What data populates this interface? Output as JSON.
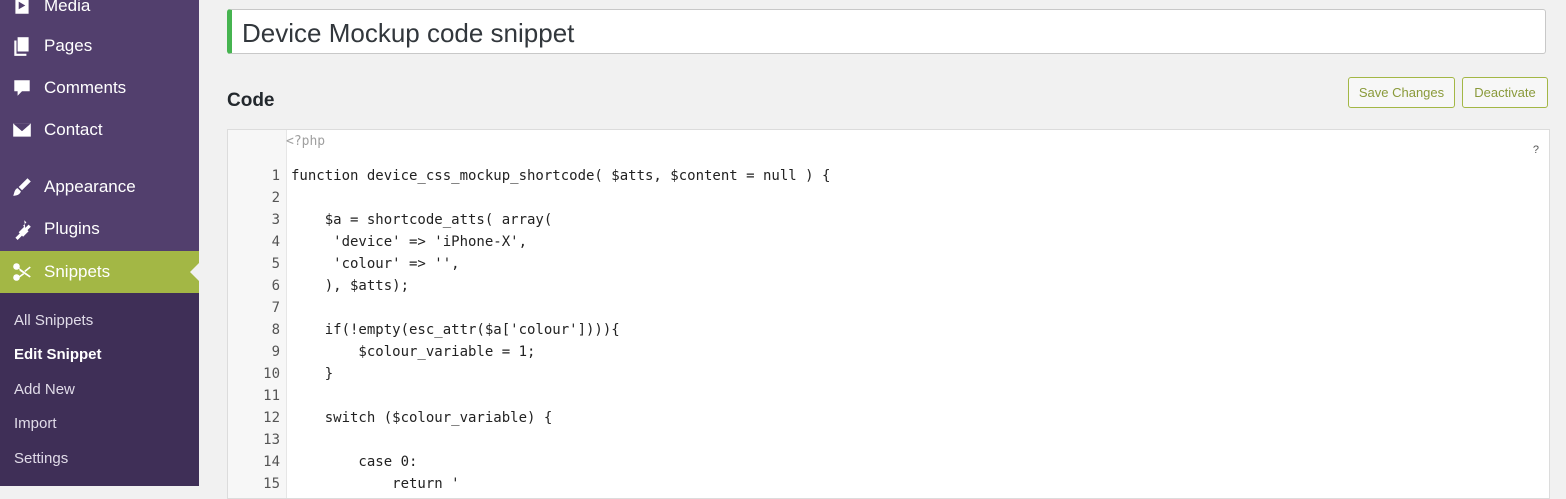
{
  "sidebar": {
    "items": [
      {
        "label": "Media",
        "icon": "media-icon"
      },
      {
        "label": "Pages",
        "icon": "pages-icon"
      },
      {
        "label": "Comments",
        "icon": "comments-icon"
      },
      {
        "label": "Contact",
        "icon": "mail-icon"
      },
      {
        "label": "Appearance",
        "icon": "paintbrush-icon"
      },
      {
        "label": "Plugins",
        "icon": "plugin-icon"
      },
      {
        "label": "Snippets",
        "icon": "scissors-icon"
      }
    ],
    "submenu": [
      "All Snippets",
      "Edit Snippet",
      "Add New",
      "Import",
      "Settings"
    ]
  },
  "title_value": "Device Mockup code snippet",
  "section_title": "Code",
  "buttons": {
    "save": "Save Changes",
    "deactivate": "Deactivate"
  },
  "editor": {
    "php_tag": "<?php",
    "help": "?",
    "lines": [
      {
        "n": "1",
        "code": "function device_css_mockup_shortcode( $atts, $content = null ) {"
      },
      {
        "n": "2",
        "code": ""
      },
      {
        "n": "3",
        "code": "    $a = shortcode_atts( array("
      },
      {
        "n": "4",
        "code": "     'device' => 'iPhone-X',"
      },
      {
        "n": "5",
        "code": "     'colour' => '',"
      },
      {
        "n": "6",
        "code": "    ), $atts);"
      },
      {
        "n": "7",
        "code": ""
      },
      {
        "n": "8",
        "code": "    if(!empty(esc_attr($a['colour']))){"
      },
      {
        "n": "9",
        "code": "        $colour_variable = 1;"
      },
      {
        "n": "10",
        "code": "    }"
      },
      {
        "n": "11",
        "code": ""
      },
      {
        "n": "12",
        "code": "    switch ($colour_variable) {"
      },
      {
        "n": "13",
        "code": ""
      },
      {
        "n": "14",
        "code": "        case 0:"
      },
      {
        "n": "15",
        "code": "            return '"
      }
    ]
  },
  "colors": {
    "sidebar": "#523f6d",
    "active": "#a3b745",
    "title_accent": "#46b450"
  }
}
